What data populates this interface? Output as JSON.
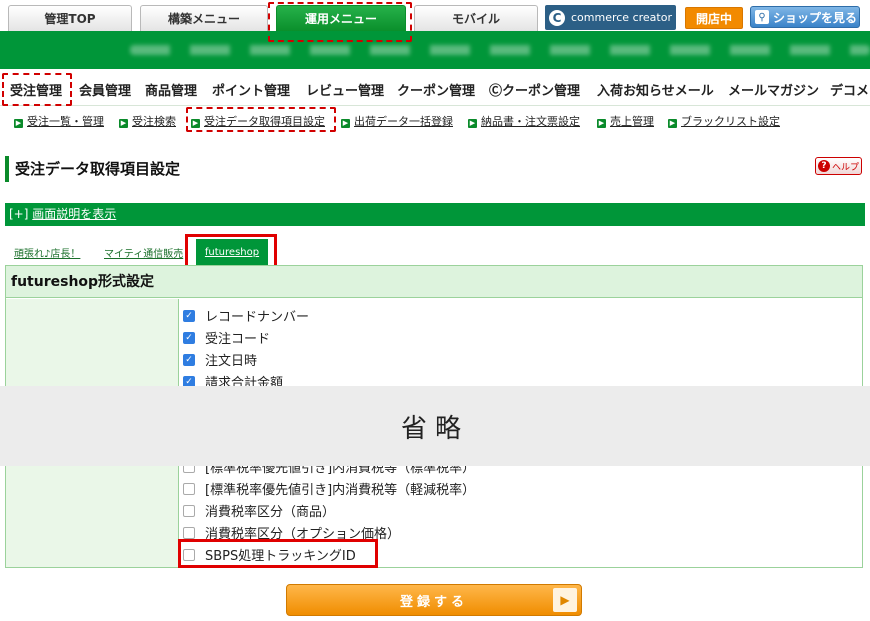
{
  "top_tabs": [
    {
      "label": "管理TOP"
    },
    {
      "label": "構築メニュー"
    },
    {
      "label": "運用メニュー"
    },
    {
      "label": "モバイル"
    }
  ],
  "commerce_creator": {
    "label": "commerce creator",
    "logo": "C"
  },
  "status_badge": "開店中",
  "shop_button": "ショップを見る",
  "main_nav": [
    {
      "label": "受注管理"
    },
    {
      "label": "会員管理"
    },
    {
      "label": "商品管理"
    },
    {
      "label": "ポイント管理"
    },
    {
      "label": "レビュー管理"
    },
    {
      "label": "クーポン管理"
    },
    {
      "label": "Ⓒクーポン管理"
    },
    {
      "label": "入荷お知らせメール"
    },
    {
      "label": "メールマガジン"
    },
    {
      "label": "デコメ"
    }
  ],
  "sub_nav": [
    {
      "label": "受注一覧・管理"
    },
    {
      "label": "受注検索"
    },
    {
      "label": "受注データ取得項目設定"
    },
    {
      "label": "出荷データ一括登録"
    },
    {
      "label": "納品書・注文票設定"
    },
    {
      "label": "売上管理"
    },
    {
      "label": "ブラックリスト設定"
    }
  ],
  "page_title": "受注データ取得項目設定",
  "help_button": "ヘルプ",
  "expander": {
    "prefix": "[+]",
    "label": "画面説明を表示"
  },
  "sub_tabs": [
    {
      "label": "頑張れ♪店長！"
    },
    {
      "label": "マイティ通信販売"
    },
    {
      "label": "futureshop"
    }
  ],
  "panel_title": "futureshop形式設定",
  "fields_top": [
    {
      "label": "レコードナンバー",
      "checked": true
    },
    {
      "label": "受注コード",
      "checked": true
    },
    {
      "label": "注文日時",
      "checked": true
    },
    {
      "label": "請求合計金額",
      "checked": true
    }
  ],
  "fields_bottom": [
    {
      "label": "[標準税率優先値引き]内消費税等（標準税率）",
      "checked": false
    },
    {
      "label": "[標準税率優先値引き]内消費税等（軽減税率）",
      "checked": false
    },
    {
      "label": "消費税率区分（商品）",
      "checked": false
    },
    {
      "label": "消費税率区分（オプション価格）",
      "checked": false
    },
    {
      "label": "SBPS処理トラッキングID",
      "checked": false
    }
  ],
  "omitted_label": "省略",
  "submit_label": "登録する"
}
